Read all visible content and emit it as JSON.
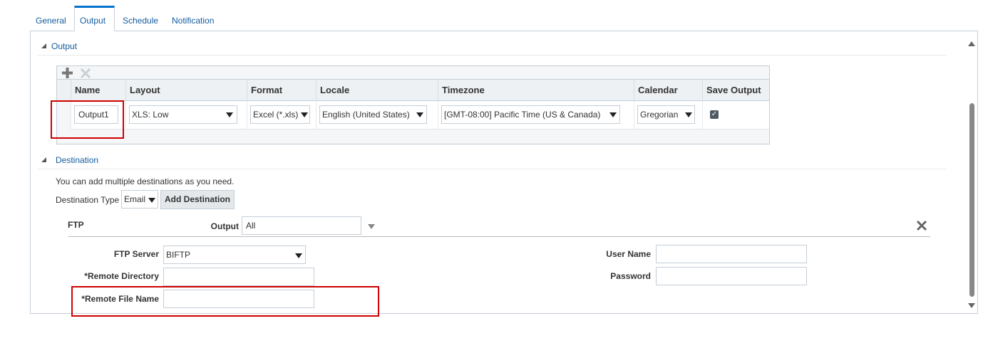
{
  "tabs": [
    {
      "label": "General",
      "active": false
    },
    {
      "label": "Output",
      "active": true
    },
    {
      "label": "Schedule",
      "active": false
    },
    {
      "label": "Notification",
      "active": false
    }
  ],
  "output_section": {
    "title": "Output",
    "columns": [
      "Name",
      "Layout",
      "Format",
      "Locale",
      "Timezone",
      "Calendar",
      "Save Output"
    ],
    "row": {
      "name": "Output1",
      "layout": "XLS: Low",
      "format": "Excel (*.xls)",
      "locale": "English (United States)",
      "timezone": "[GMT-08:00] Pacific Time (US & Canada)",
      "calendar": "Gregorian",
      "save_output": true
    }
  },
  "destination_section": {
    "title": "Destination",
    "hint": "You can add multiple destinations as you need.",
    "type_label": "Destination Type",
    "type_value": "Email",
    "add_button": "Add Destination",
    "ftp": {
      "title": "FTP",
      "output_label": "Output",
      "output_value": "All",
      "ftp_server_label": "FTP Server",
      "ftp_server_value": "BIFTP",
      "remote_directory_label": "*Remote Directory",
      "remote_directory_value": "",
      "remote_file_name_label": "*Remote File Name",
      "remote_file_name_value": "",
      "user_name_label": "User Name",
      "user_name_value": "",
      "password_label": "Password",
      "password_value": ""
    }
  },
  "colors": {
    "accent": "#0572ce",
    "link": "#145c9e",
    "highlight": "#d00000"
  }
}
